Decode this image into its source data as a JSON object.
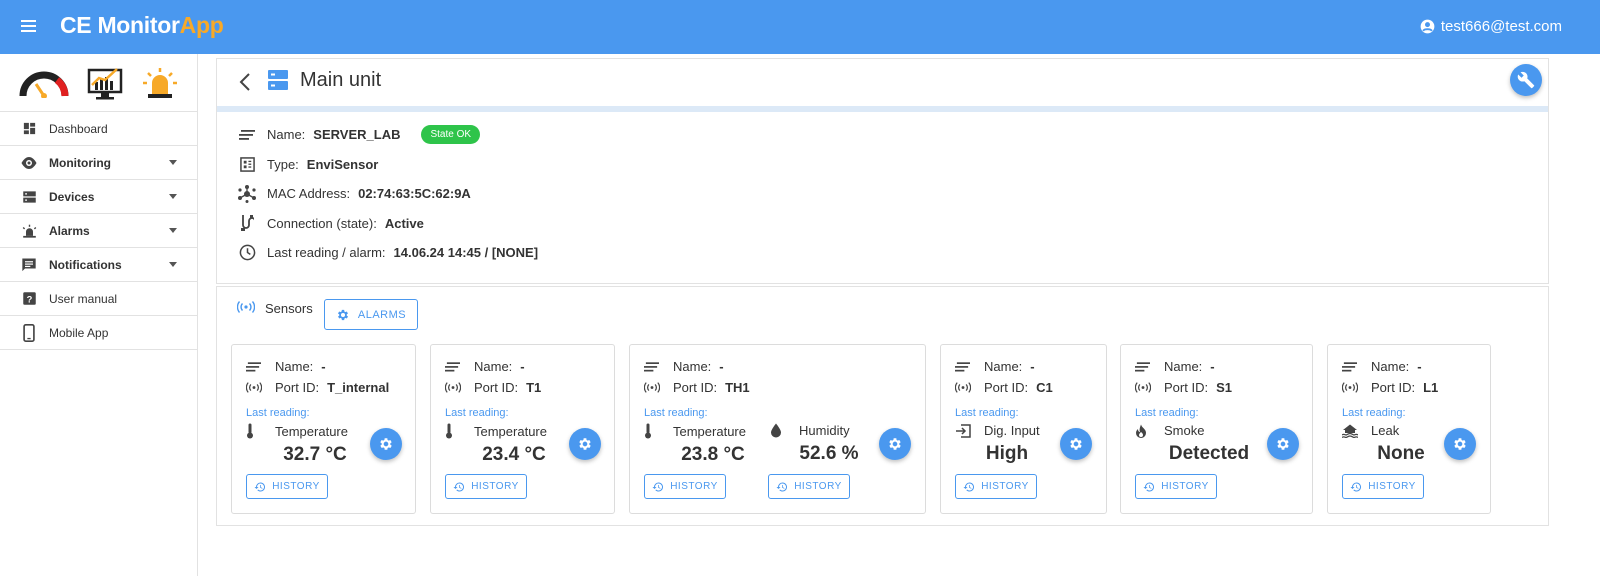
{
  "app": {
    "title_main": "CE Monitor",
    "title_accent": "App",
    "user_email": "test666@test.com",
    "menu_icon": "hamburger-menu-icon",
    "colors": {
      "primary": "#4a98ef",
      "accent": "#f7a928",
      "ok": "#2ec44a"
    }
  },
  "sidebar": {
    "top_icons": [
      "gauge-icon",
      "chart-monitor-icon",
      "alarm-siren-icon"
    ],
    "items": [
      {
        "label": "Dashboard",
        "icon": "dashboard-icon",
        "expandable": false
      },
      {
        "label": "Monitoring",
        "icon": "eye-icon",
        "expandable": true
      },
      {
        "label": "Devices",
        "icon": "server-icon",
        "expandable": true
      },
      {
        "label": "Alarms",
        "icon": "alarm-light-icon",
        "expandable": true
      },
      {
        "label": "Notifications",
        "icon": "message-icon",
        "expandable": true
      },
      {
        "label": "User manual",
        "icon": "help-icon",
        "expandable": false
      },
      {
        "label": "Mobile App",
        "icon": "phone-icon",
        "expandable": false
      }
    ]
  },
  "unit": {
    "title": "Main unit",
    "info": {
      "name_label": "Name:",
      "name_value": "SERVER_LAB",
      "state_badge": "State OK",
      "type_label": "Type:",
      "type_value": "EnviSensor",
      "mac_label": "MAC Address:",
      "mac_value": "02:74:63:5C:62:9A",
      "conn_label": "Connection (state):",
      "conn_value": "Active",
      "last_label": "Last reading / alarm:",
      "last_value": "14.06.24 14:45 / [NONE]"
    }
  },
  "sensors": {
    "title": "Sensors",
    "alarms_button": "ALARMS",
    "name_label": "Name:",
    "port_label": "Port ID:",
    "last_reading_label": "Last reading:",
    "history_label": "HISTORY",
    "cards": [
      {
        "name": "-",
        "port": "T_internal",
        "quantities": [
          {
            "label": "Temperature",
            "value": "32.7 °C",
            "icon": "thermometer-icon"
          }
        ]
      },
      {
        "name": "-",
        "port": "T1",
        "quantities": [
          {
            "label": "Temperature",
            "value": "23.4 °C",
            "icon": "thermometer-icon"
          }
        ]
      },
      {
        "name": "-",
        "port": "TH1",
        "quantities": [
          {
            "label": "Temperature",
            "value": "23.8 °C",
            "icon": "thermometer-icon"
          },
          {
            "label": "Humidity",
            "value": "52.6 %",
            "icon": "water-drop-icon"
          }
        ]
      },
      {
        "name": "-",
        "port": "C1",
        "quantities": [
          {
            "label": "Dig. Input",
            "value": "High",
            "icon": "digital-input-icon"
          }
        ]
      },
      {
        "name": "-",
        "port": "S1",
        "quantities": [
          {
            "label": "Smoke",
            "value": "Detected",
            "icon": "fire-icon"
          }
        ]
      },
      {
        "name": "-",
        "port": "L1",
        "quantities": [
          {
            "label": "Leak",
            "value": "None",
            "icon": "flood-icon"
          }
        ]
      }
    ]
  }
}
